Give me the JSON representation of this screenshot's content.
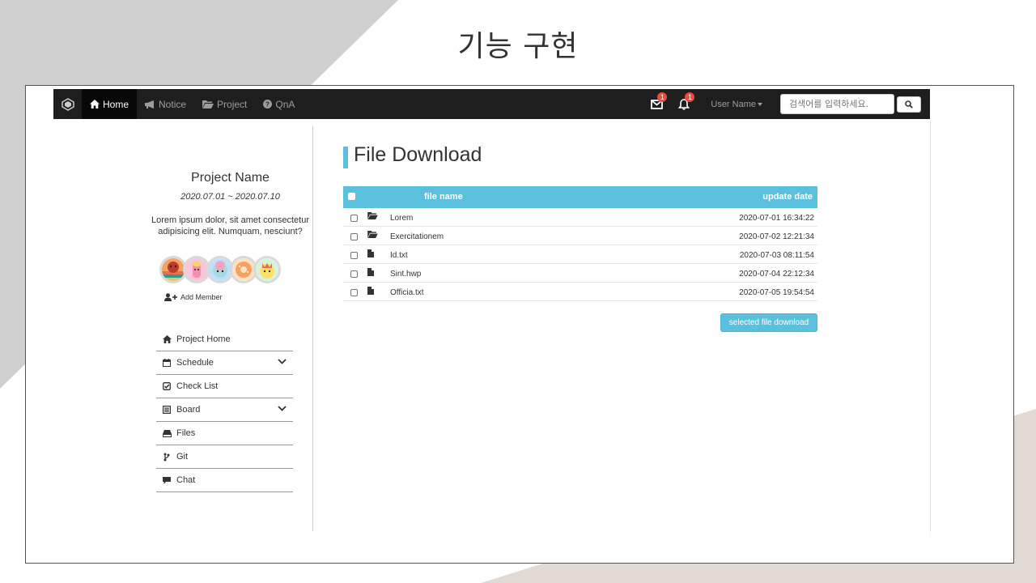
{
  "slide": {
    "title": "기능 구현"
  },
  "navbar": {
    "brand_icon": "cube-logo-icon",
    "items": [
      {
        "label": "Home",
        "icon": "home-icon",
        "active": true
      },
      {
        "label": "Notice",
        "icon": "megaphone-icon"
      },
      {
        "label": "Project",
        "icon": "folder-open-icon"
      },
      {
        "label": "QnA",
        "icon": "question-circle-icon"
      }
    ],
    "mail_badge": "1",
    "bell_badge": "1",
    "user_label": "User Name",
    "search_placeholder": "검색어를 입력하세요."
  },
  "sidebar": {
    "project_name": "Project Name",
    "date_range": "2020.07.01 ~ 2020.07.10",
    "description": "Lorem ipsum dolor, sit amet consectetur adipisicing elit. Numquam, nesciunt?",
    "add_member": "Add Member",
    "menu": [
      {
        "label": "Project Home",
        "icon": "home-icon",
        "expandable": false
      },
      {
        "label": "Schedule",
        "icon": "calendar-icon",
        "expandable": true
      },
      {
        "label": "Check List",
        "icon": "check-square-icon",
        "expandable": false
      },
      {
        "label": "Board",
        "icon": "list-alt-icon",
        "expandable": true
      },
      {
        "label": "Files",
        "icon": "hdd-icon",
        "expandable": false
      },
      {
        "label": "Git",
        "icon": "git-branch-icon",
        "expandable": false
      },
      {
        "label": "Chat",
        "icon": "comment-icon",
        "expandable": false
      }
    ]
  },
  "main": {
    "title": "File Download",
    "columns": {
      "name": "file name",
      "date": "update date"
    },
    "files": [
      {
        "name": "Lorem",
        "type": "folder",
        "date": "2020-07-01 16:34:22"
      },
      {
        "name": "Exercitationem",
        "type": "folder",
        "date": "2020-07-02 12:21:34"
      },
      {
        "name": "Id.txt",
        "type": "file",
        "date": "2020-07-03 08:11:54"
      },
      {
        "name": "Sint.hwp",
        "type": "file",
        "date": "2020-07-04 22:12:34"
      },
      {
        "name": "Officia.txt",
        "type": "file",
        "date": "2020-07-05 19:54:54"
      }
    ],
    "download_button": "selected file download"
  },
  "colors": {
    "accent": "#5bc0de",
    "navbar": "#1e1e1e",
    "badge": "#e74c3c"
  }
}
